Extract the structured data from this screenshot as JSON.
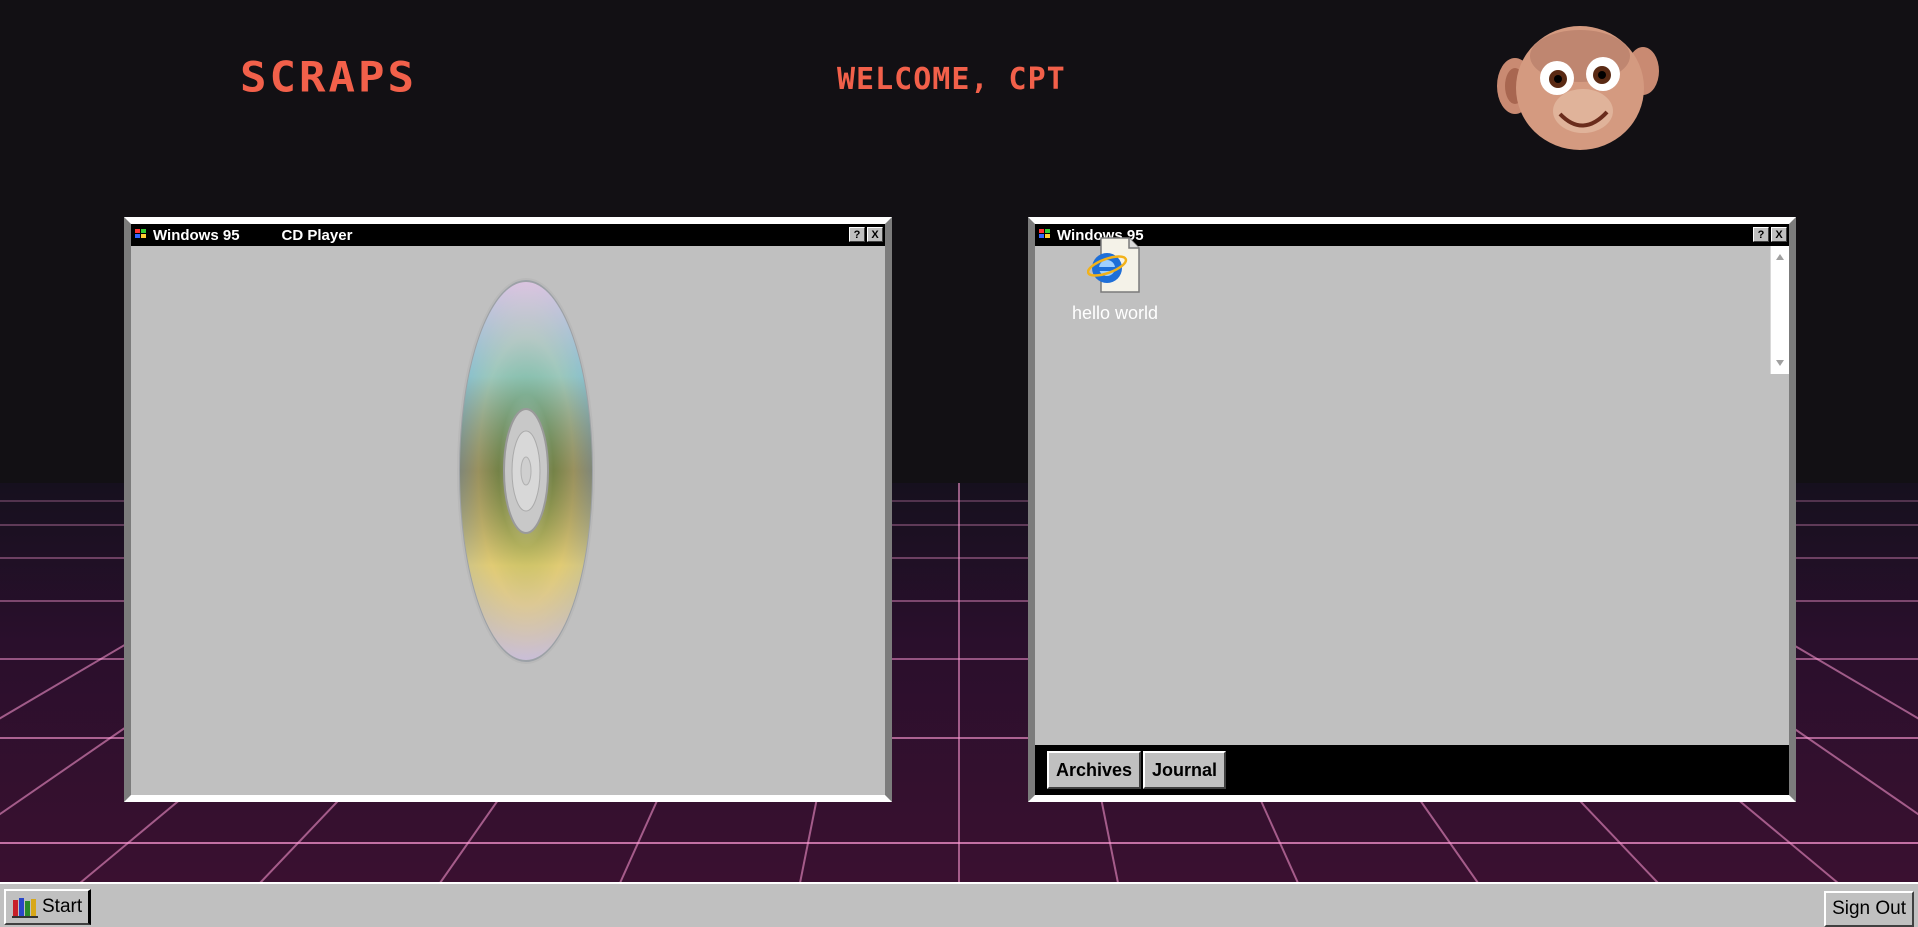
{
  "header": {
    "brand": "SCRAPS",
    "welcome": "WELCOME, CPT",
    "mascot_icon": "monkey-face-icon"
  },
  "colors": {
    "accent": "#f2604a",
    "background": "#121014",
    "window_face": "#c0c0c0",
    "titlebar": "#000000"
  },
  "cd_window": {
    "title": "Windows 95",
    "subtitle": "CD Player",
    "help_label": "?",
    "close_label": "X",
    "disc_icon": "compact-disc-icon"
  },
  "explorer_window": {
    "title": "Windows 95",
    "help_label": "?",
    "close_label": "X",
    "file": {
      "label": "hello world",
      "icon": "internet-explorer-file-icon"
    },
    "buttons": [
      "Archives",
      "Journal"
    ]
  },
  "taskbar": {
    "start_label": "Start",
    "signout_label": "Sign Out"
  }
}
